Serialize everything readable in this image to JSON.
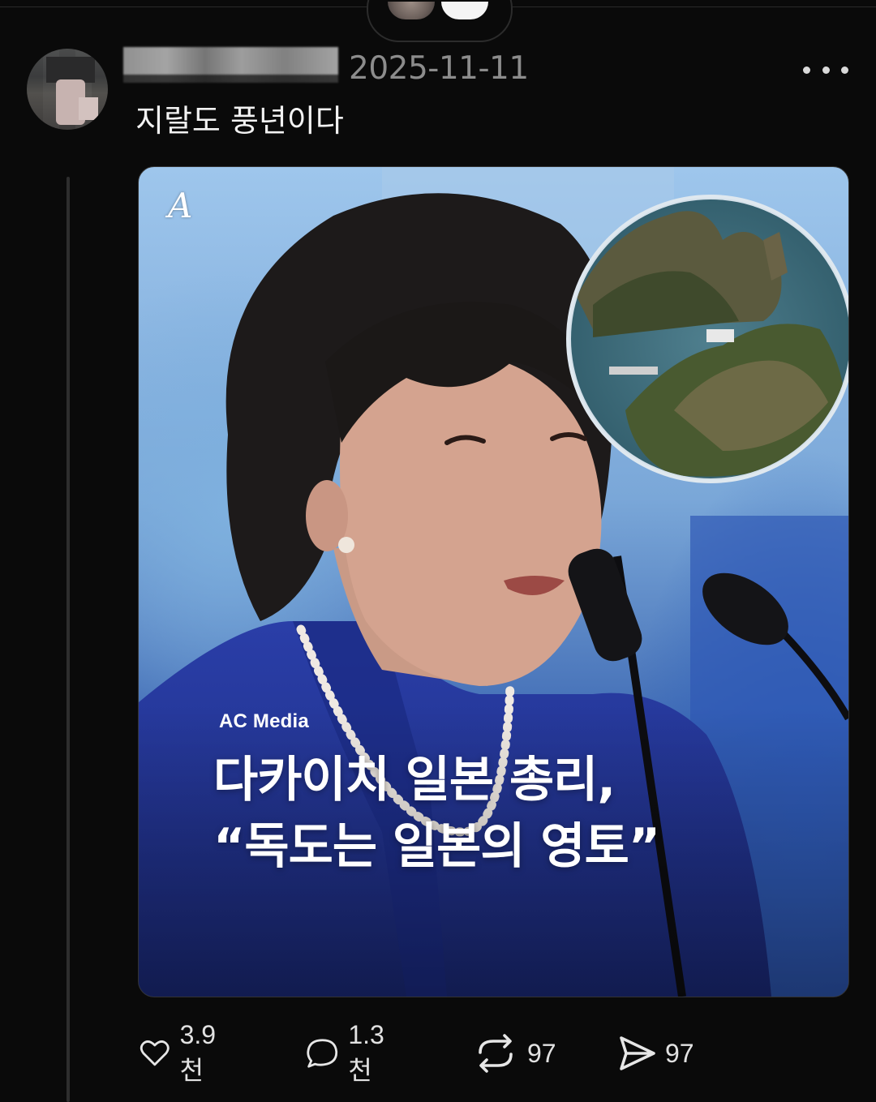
{
  "post": {
    "timestamp": "2025-11-11",
    "text": "지랄도 풍년이다"
  },
  "media": {
    "source": "AC Media",
    "headline_line1": "다카이치 일본 총리,",
    "headline_line2": "“독도는 일본의 영토”",
    "logo_letter": "A"
  },
  "actions": {
    "likes": "3.9천",
    "replies": "1.3천",
    "reposts": "97",
    "shares": "97"
  },
  "icons": {
    "like": "heart-icon",
    "reply": "speech-bubble-icon",
    "repost": "repost-icon",
    "share": "send-icon",
    "more": "more-dots-icon"
  },
  "colors": {
    "background": "#0a0a0a",
    "text_primary": "#f2f2f2",
    "text_secondary": "#8c8c8c"
  }
}
